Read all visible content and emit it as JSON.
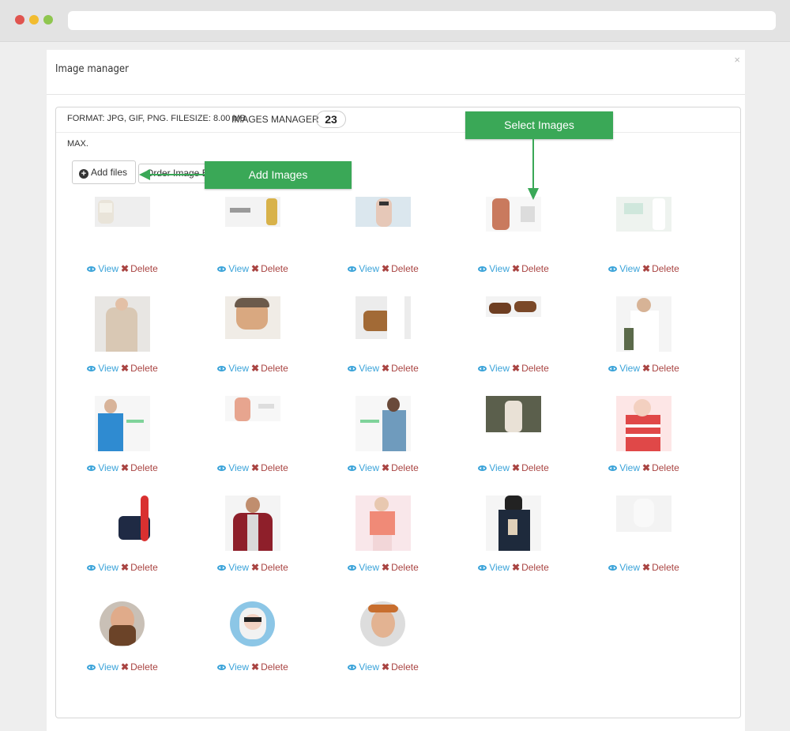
{
  "modal": {
    "title": "Image manager",
    "close": "×"
  },
  "panel": {
    "format_info": "FORMAT: JPG, GIF, PNG. FILESIZE: 8.00 MB",
    "format_info_line2": "MAX.",
    "manager_label": "IMAGES MANAGER",
    "count": "23",
    "add_files_label": "Add files",
    "order_label": "Order Image By"
  },
  "callouts": {
    "add_images": "Add Images",
    "select_images": "Select Images"
  },
  "actions": {
    "view": "View",
    "delete": "Delete"
  },
  "colors": {
    "callout_green": "#3aa857",
    "view_blue": "#3aa3d9",
    "delete_red": "#a94442"
  },
  "images": [
    {
      "subject": "man in white t-shirt"
    },
    {
      "subject": "50% sale banner"
    },
    {
      "subject": "woman in sunglasses"
    },
    {
      "subject": "woman in floral top"
    },
    {
      "subject": "style banner woman"
    },
    {
      "subject": "man in beige coat"
    },
    {
      "subject": "man in flat cap"
    },
    {
      "subject": "brown handbag"
    },
    {
      "subject": "brown shoes"
    },
    {
      "subject": "man with bag"
    },
    {
      "subject": "men's tank top banner"
    },
    {
      "subject": "woman banner"
    },
    {
      "subject": "women's dress banner"
    },
    {
      "subject": "woman in forest"
    },
    {
      "subject": "woman in striped top"
    },
    {
      "subject": "navy bag with red strap"
    },
    {
      "subject": "man in red jacket"
    },
    {
      "subject": "woman in striped sweater"
    },
    {
      "subject": "woman in dark coat"
    },
    {
      "subject": "light portrait"
    },
    {
      "subject": "bearded man avatar"
    },
    {
      "subject": "woman with sunglasses avatar"
    },
    {
      "subject": "man laughing avatar"
    }
  ]
}
